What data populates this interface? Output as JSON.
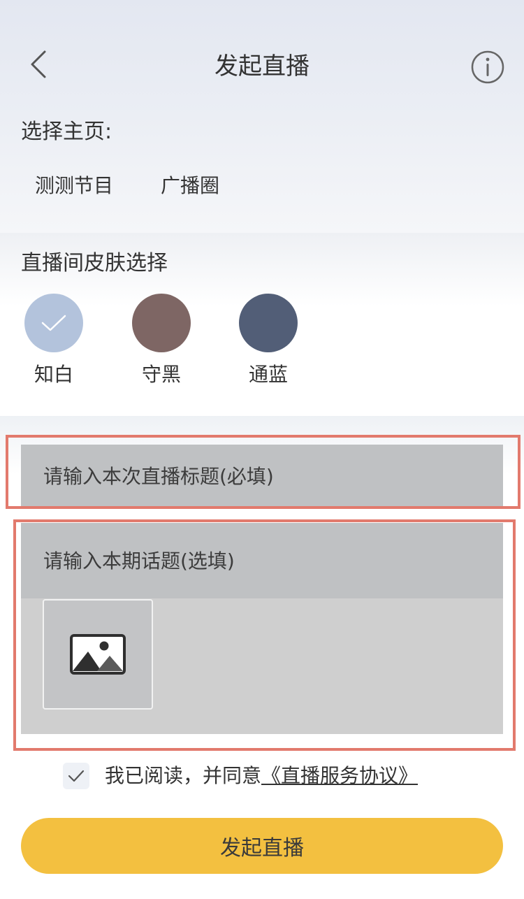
{
  "header": {
    "title": "发起直播",
    "back_icon": "chevron-left-icon",
    "info_icon": "info-icon"
  },
  "home_select": {
    "label": "选择主页:",
    "items": [
      {
        "label": "测测节目"
      },
      {
        "label": "广播圈"
      }
    ]
  },
  "skin_select": {
    "label": "直播间皮肤选择",
    "options": [
      {
        "name": "知白",
        "color": "#b3c3dc",
        "selected": true
      },
      {
        "name": "守黑",
        "color": "#7e6664",
        "selected": false
      },
      {
        "name": "通蓝",
        "color": "#525e77",
        "selected": false
      }
    ]
  },
  "form": {
    "title_placeholder": "请输入本次直播标题(必填)",
    "topic_placeholder": "请输入本期话题(选填)",
    "image_icon": "image-icon",
    "highlight_color": "#e27a6d"
  },
  "agreement": {
    "checked": true,
    "text": "我已阅读，并同意",
    "link": "《直播服务协议》"
  },
  "submit": {
    "label": "发起直播",
    "color": "#f3c040"
  }
}
